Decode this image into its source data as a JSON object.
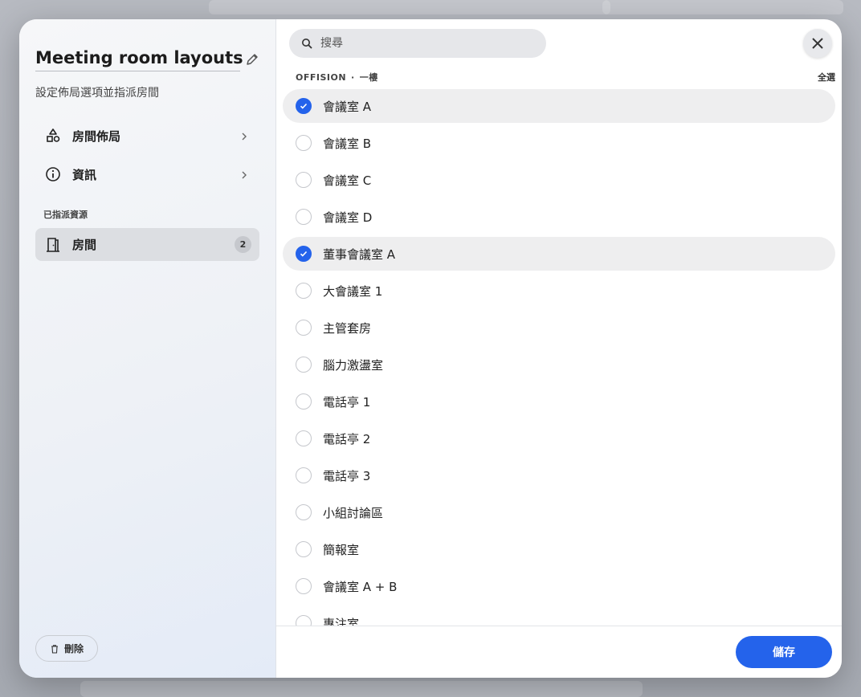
{
  "panel": {
    "title": "Meeting room layouts",
    "subtitle": "設定佈局選項並指派房間",
    "nav": [
      {
        "label": "房間佈局",
        "icon": "shapes-icon"
      },
      {
        "label": "資訊",
        "icon": "info-icon"
      }
    ],
    "assigned_section_label": "已指派資源",
    "assigned_item": {
      "label": "房間",
      "count": "2",
      "icon": "door-icon"
    },
    "delete_label": "刪除"
  },
  "search": {
    "placeholder": "搜尋"
  },
  "group": {
    "building": "OFFISION",
    "separator": "·",
    "floor": "一樓",
    "select_all": "全選"
  },
  "rooms": [
    {
      "name": "會議室 A",
      "selected": true
    },
    {
      "name": "會議室 B",
      "selected": false
    },
    {
      "name": "會議室 C",
      "selected": false
    },
    {
      "name": "會議室 D",
      "selected": false
    },
    {
      "name": "董事會議室 A",
      "selected": true
    },
    {
      "name": "大會議室 1",
      "selected": false
    },
    {
      "name": "主管套房",
      "selected": false
    },
    {
      "name": "腦力激盪室",
      "selected": false
    },
    {
      "name": "電話亭 1",
      "selected": false
    },
    {
      "name": "電話亭 2",
      "selected": false
    },
    {
      "name": "電話亭 3",
      "selected": false
    },
    {
      "name": "小組討論區",
      "selected": false
    },
    {
      "name": "簡報室",
      "selected": false
    },
    {
      "name": "會議室 A + B",
      "selected": false
    },
    {
      "name": "專注室",
      "selected": false
    }
  ],
  "footer": {
    "save_label": "儲存"
  },
  "colors": {
    "accent": "#2463eb",
    "selected_row": "#eeeeef"
  }
}
